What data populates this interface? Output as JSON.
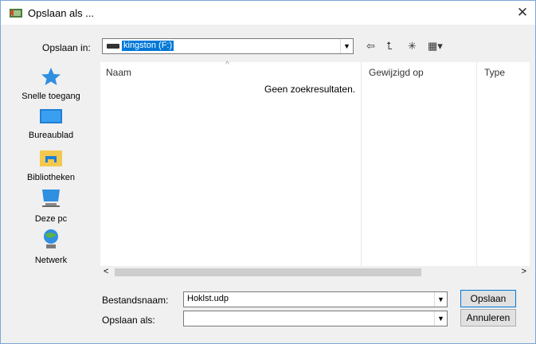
{
  "window": {
    "title": "Opslaan als ...",
    "close_glyph": "✕"
  },
  "location": {
    "label": "Opslaan in:",
    "value": "kingston  (F:)"
  },
  "toolbar": {
    "back_glyph": "⇦",
    "up_glyph": "⮤",
    "new_folder_glyph": "✳",
    "view_glyph": "▦▾"
  },
  "places": [
    {
      "label": "Snelle toegang",
      "icon": "star-icon"
    },
    {
      "label": "Bureaublad",
      "icon": "desktop-icon"
    },
    {
      "label": "Bibliotheken",
      "icon": "libraries-icon"
    },
    {
      "label": "Deze pc",
      "icon": "computer-icon"
    },
    {
      "label": "Netwerk",
      "icon": "network-icon"
    }
  ],
  "columns": {
    "name": "Naam",
    "modified": "Gewijzigd op",
    "type": "Type"
  },
  "empty_message": "Geen zoekresultaten.",
  "scrollbar": {
    "left": "<",
    "right": ">"
  },
  "filename": {
    "label": "Bestandsnaam:",
    "value": "Hoklst.udp"
  },
  "filetype": {
    "label": "Opslaan als:",
    "value": ""
  },
  "buttons": {
    "save": "Opslaan",
    "cancel": "Annuleren"
  },
  "colors": {
    "accent": "#0078d7",
    "places_icon": "#2f8fe0"
  }
}
